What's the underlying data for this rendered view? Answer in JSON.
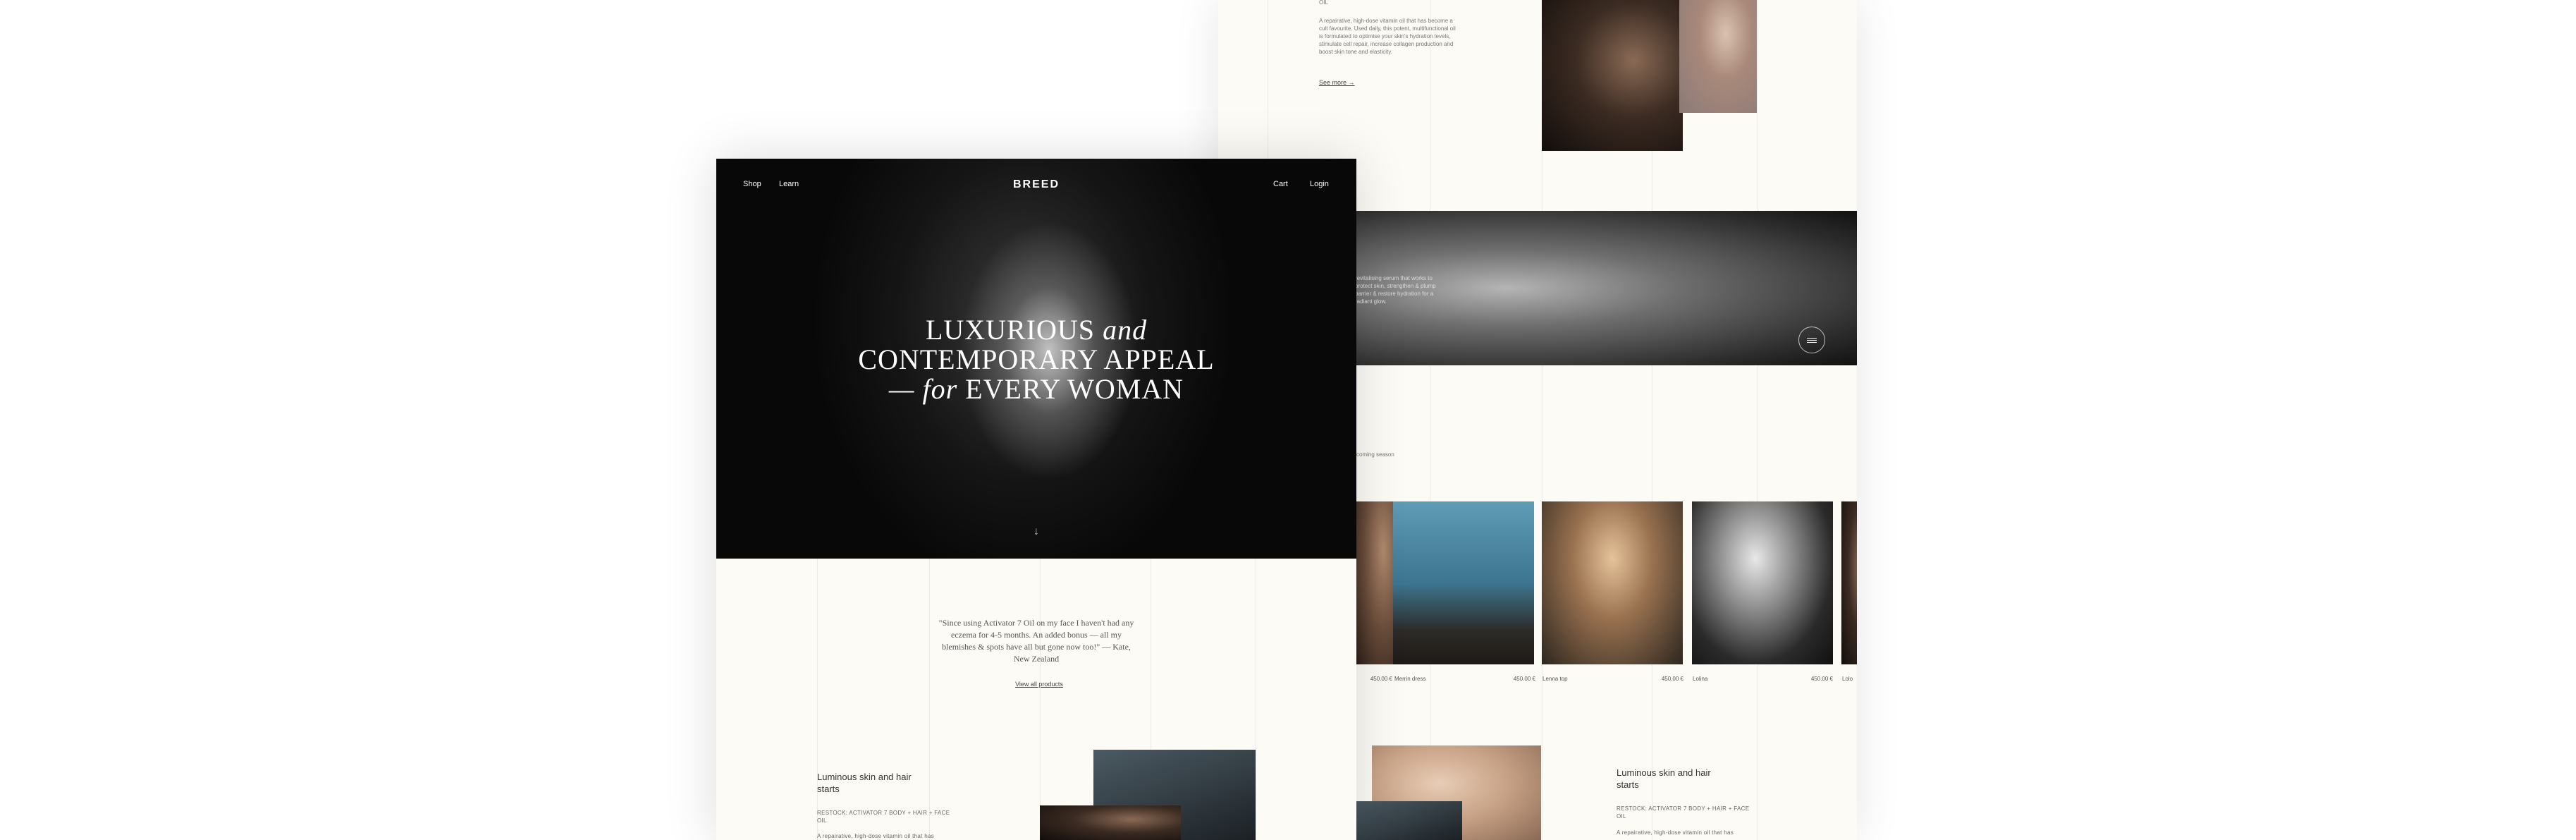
{
  "nav": {
    "shop": "Shop",
    "learn": "Learn",
    "brand": "BREED",
    "cart": "Cart",
    "login": "Login"
  },
  "hero": {
    "line1_a": "LUXURIOUS",
    "line1_b": "and",
    "line2": "CONTEMPORARY APPEAL",
    "line3_a": "— for",
    "line3_b": "EVERY WOMAN"
  },
  "testimonial": {
    "quote": "\"Since using Activator 7 Oil on my face I haven't had any eczema for 4-5 months. An added bonus — all my blemishes & spots have all but gone now too!\" — Kate, New Zealand",
    "view_all": "View all products"
  },
  "feature": {
    "title": "Luminous skin and hair starts",
    "restock": "RESTOCK: ACTIVATOR 7 BODY + HAIR + FACE OIL",
    "body": "A repairative, high-dose vitamin oil that has become a cult favourite. Used daily, this potent, multifunctional oil is formulated to optimise your skin's hydration levels, stimulate cell repair, increase collagen production and boost skin tone and elasticity.",
    "see_more": "See more →",
    "body_short": "A repairative, high-dose vitamin oil that has"
  },
  "season": {
    "label": "coming season"
  },
  "products": [
    {
      "name": "",
      "price": "450.00 €"
    },
    {
      "name": "Merrin dress",
      "price": "450.00 €"
    },
    {
      "name": "Lenna top",
      "price": "450.00 €"
    },
    {
      "name": "Lolina",
      "price": "450.00 €"
    },
    {
      "name": "Lolo",
      "price": ""
    }
  ],
  "closeup_text": {
    "a": "revitalising serum that works to",
    "b": "protect skin, strengthen & plump",
    "c": "barrier & restore hydration for a",
    "d": "radiant glow."
  },
  "colors": {
    "background": "#fcfbf6",
    "hero": "#0b0b0b",
    "text": "#2a2a2a"
  },
  "icons": [
    "menu-circle-icon",
    "arrow-down-icon"
  ]
}
